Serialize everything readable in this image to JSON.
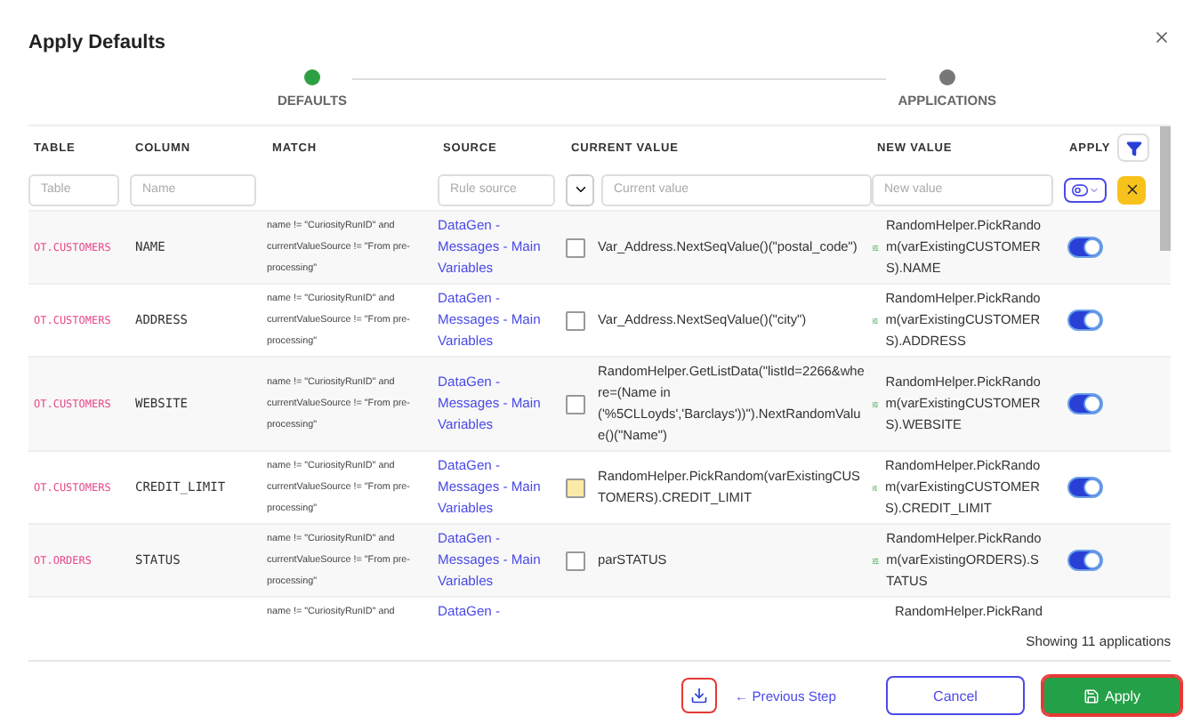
{
  "window": {
    "title": "Apply Defaults"
  },
  "steps": [
    {
      "label": "DEFAULTS",
      "selected": true
    },
    {
      "label": "APPLICATIONS",
      "selected": false
    }
  ],
  "table": {
    "columns": [
      "TABLE",
      "COLUMN",
      "MATCH",
      "SOURCE",
      "CURRENT VALUE",
      "NEW VALUE",
      "APPLY"
    ],
    "filters": {
      "table": {
        "placeholder": "Table"
      },
      "column": {
        "placeholder": "Name"
      },
      "source": {
        "placeholder": "Rule source"
      },
      "current_value": {
        "placeholder": "Current value"
      },
      "new_value": {
        "placeholder": "New value"
      }
    },
    "rows": [
      {
        "table": "OT.CUSTOMERS",
        "column": "NAME",
        "match": "name != \"CuriosityRunID\" and currentValueSource != \"From pre-processing\"",
        "source": "DataGen - Messages - Main Variables",
        "current_checked": false,
        "current_value": "Var_Address.NextSeqValue()(\"postal_code\")",
        "new_value": "RandomHelper.PickRandom(varExistingCUSTOMERS).NAME",
        "apply": true
      },
      {
        "table": "OT.CUSTOMERS",
        "column": "ADDRESS",
        "match": "name != \"CuriosityRunID\" and currentValueSource != \"From pre-processing\"",
        "source": "DataGen - Messages - Main Variables",
        "current_checked": false,
        "current_value": "Var_Address.NextSeqValue()(\"city\")",
        "new_value": "RandomHelper.PickRandom(varExistingCUSTOMERS).ADDRESS",
        "apply": true
      },
      {
        "table": "OT.CUSTOMERS",
        "column": "WEBSITE",
        "match": "name != \"CuriosityRunID\" and currentValueSource != \"From pre-processing\"",
        "source": "DataGen - Messages - Main Variables",
        "current_checked": false,
        "current_value": "RandomHelper.GetListData(\"listId=2266&where=(Name in ('%5CLLoyds','Barclays'))\").NextRandomValue()(\"Name\")",
        "new_value": "RandomHelper.PickRandom(varExistingCUSTOMERS).WEBSITE",
        "apply": true
      },
      {
        "table": "OT.CUSTOMERS",
        "column": "CREDIT_LIMIT",
        "match": "name != \"CuriosityRunID\" and currentValueSource != \"From pre-processing\"",
        "source": "DataGen - Messages - Main Variables",
        "current_checked": true,
        "current_value": "RandomHelper.PickRandom(varExistingCUSTOMERS).CREDIT_LIMIT",
        "new_value": "RandomHelper.PickRandom(varExistingCUSTOMERS).CREDIT_LIMIT",
        "apply": true
      },
      {
        "table": "OT.ORDERS",
        "column": "STATUS",
        "match": "name != \"CuriosityRunID\" and currentValueSource != \"From pre-processing\"",
        "source": "DataGen - Messages - Main Variables",
        "current_checked": false,
        "current_value": "parSTATUS",
        "new_value": "RandomHelper.PickRandom(varExistingORDERS).STATUS",
        "apply": true
      },
      {
        "match": "name != \"CuriosityRunID\" and",
        "source": "DataGen -",
        "new_value": "RandomHelper.PickRand"
      }
    ],
    "count": "Showing 11 applications"
  },
  "footer": {
    "previous": "← Previous Step",
    "cancel": "Cancel",
    "apply": "Apply",
    "download_highlighted": true,
    "apply_highlighted": true
  }
}
